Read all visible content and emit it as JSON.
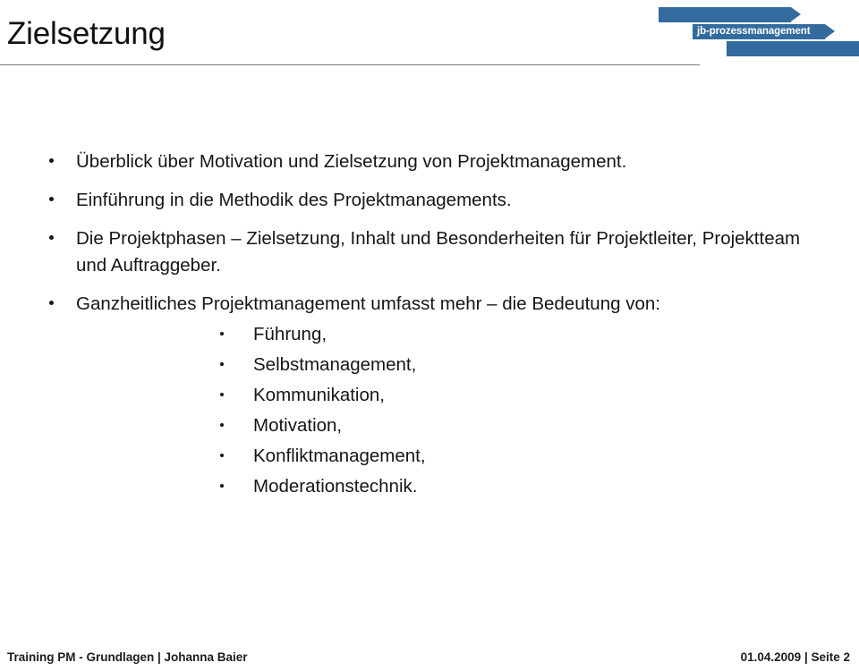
{
  "header": {
    "title": "Zielsetzung",
    "rule_color": "#7a7a7a"
  },
  "logo": {
    "text": "jb-prozessmanagement",
    "color": "#336b9e",
    "shape": "three-stacked-arrows"
  },
  "content": {
    "bullets": [
      {
        "text": "Überblick über Motivation und Zielsetzung von Projektmanagement."
      },
      {
        "text": "Einführung in die Methodik des Projektmanagements."
      },
      {
        "text": "Die Projektphasen – Zielsetzung, Inhalt und Besonderheiten für Projektleiter, Projektteam und Auftraggeber."
      },
      {
        "text": "Ganzheitliches Projektmanagement umfasst mehr – die Bedeutung von:",
        "sub_items": [
          "Führung,",
          "Selbstmanagement,",
          "Kommunikation,",
          "Motivation,",
          "Konfliktmanagement,",
          "Moderationstechnik."
        ]
      }
    ]
  },
  "footer": {
    "left": "Training PM - Grundlagen  | Johanna Baier",
    "right": "01.04.2009  | Seite 2"
  }
}
